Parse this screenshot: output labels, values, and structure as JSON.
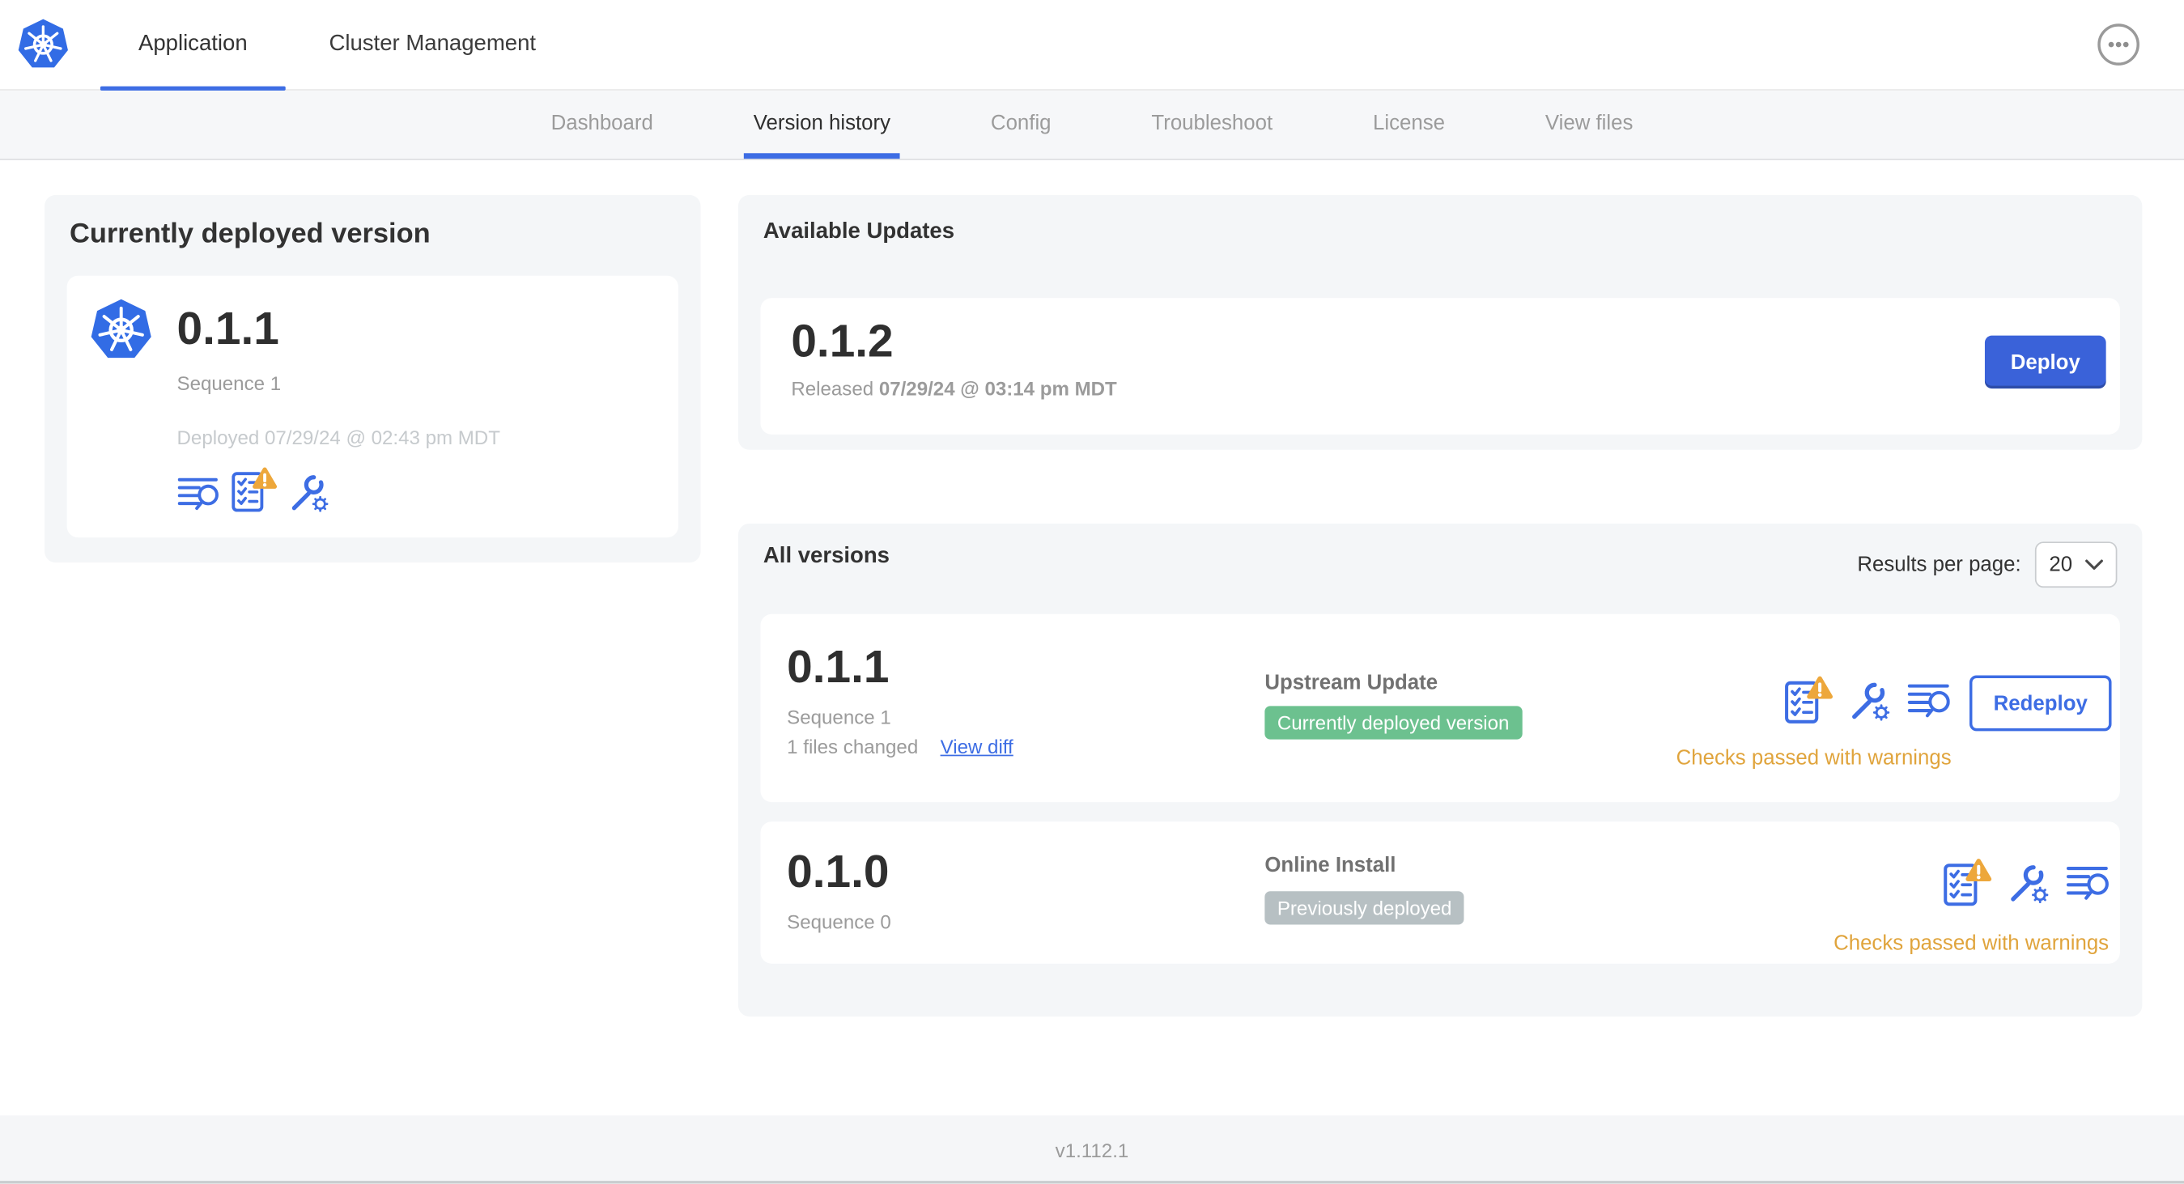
{
  "top_nav": {
    "brand_icon": "kubernetes-logo",
    "tabs": [
      {
        "label": "Application",
        "active": true
      },
      {
        "label": "Cluster Management",
        "active": false
      }
    ],
    "overflow_menu_icon": "ellipsis"
  },
  "sub_nav": {
    "items": [
      {
        "label": "Dashboard",
        "active": false
      },
      {
        "label": "Version history",
        "active": true
      },
      {
        "label": "Config",
        "active": false
      },
      {
        "label": "Troubleshoot",
        "active": false
      },
      {
        "label": "License",
        "active": false
      },
      {
        "label": "View files",
        "active": false
      }
    ]
  },
  "deployed_card": {
    "title": "Currently deployed version",
    "version": "0.1.1",
    "sequence": "Sequence 1",
    "deployed_at": "Deployed 07/29/24 @ 02:43 pm MDT",
    "icons": [
      "release-notes",
      "preflight-checks-warning",
      "config"
    ]
  },
  "available_updates": {
    "title": "Available Updates",
    "version": "0.1.2",
    "released_prefix": "Released",
    "released_date": "07/29/24 @ 03:14 pm MDT",
    "deploy_label": "Deploy"
  },
  "all_versions": {
    "title": "All versions",
    "results_per_page_label": "Results per page:",
    "results_per_page_value": "20",
    "rows": [
      {
        "version": "0.1.1",
        "sequence": "Sequence 1",
        "files_changed": "1 files changed",
        "view_diff_label": "View diff",
        "source_type": "Upstream Update",
        "status_badge": "Currently deployed version",
        "status_badge_style": "success",
        "icons": [
          "preflight-checks-warning",
          "config",
          "release-notes"
        ],
        "action_label": "Redeploy",
        "checks_text": "Checks passed with warnings"
      },
      {
        "version": "0.1.0",
        "sequence": "Sequence 0",
        "source_type": "Online Install",
        "status_badge": "Previously deployed",
        "status_badge_style": "muted",
        "icons": [
          "preflight-checks-warning",
          "config",
          "release-notes"
        ],
        "checks_text": "Checks passed with warnings"
      }
    ]
  },
  "footer": {
    "app_version": "v1.112.1"
  },
  "colors": {
    "accent_blue": "#3D6DE4",
    "kubernetes_blue": "#326CE5",
    "warning_amber": "#EDA73B",
    "warning_text": "#E0A43C",
    "success_badge_green": "#6CC18F",
    "muted_badge_gray": "#B7C0C3",
    "panel_gray": "#F4F6F8",
    "subnav_gray": "#F6F7F9"
  }
}
